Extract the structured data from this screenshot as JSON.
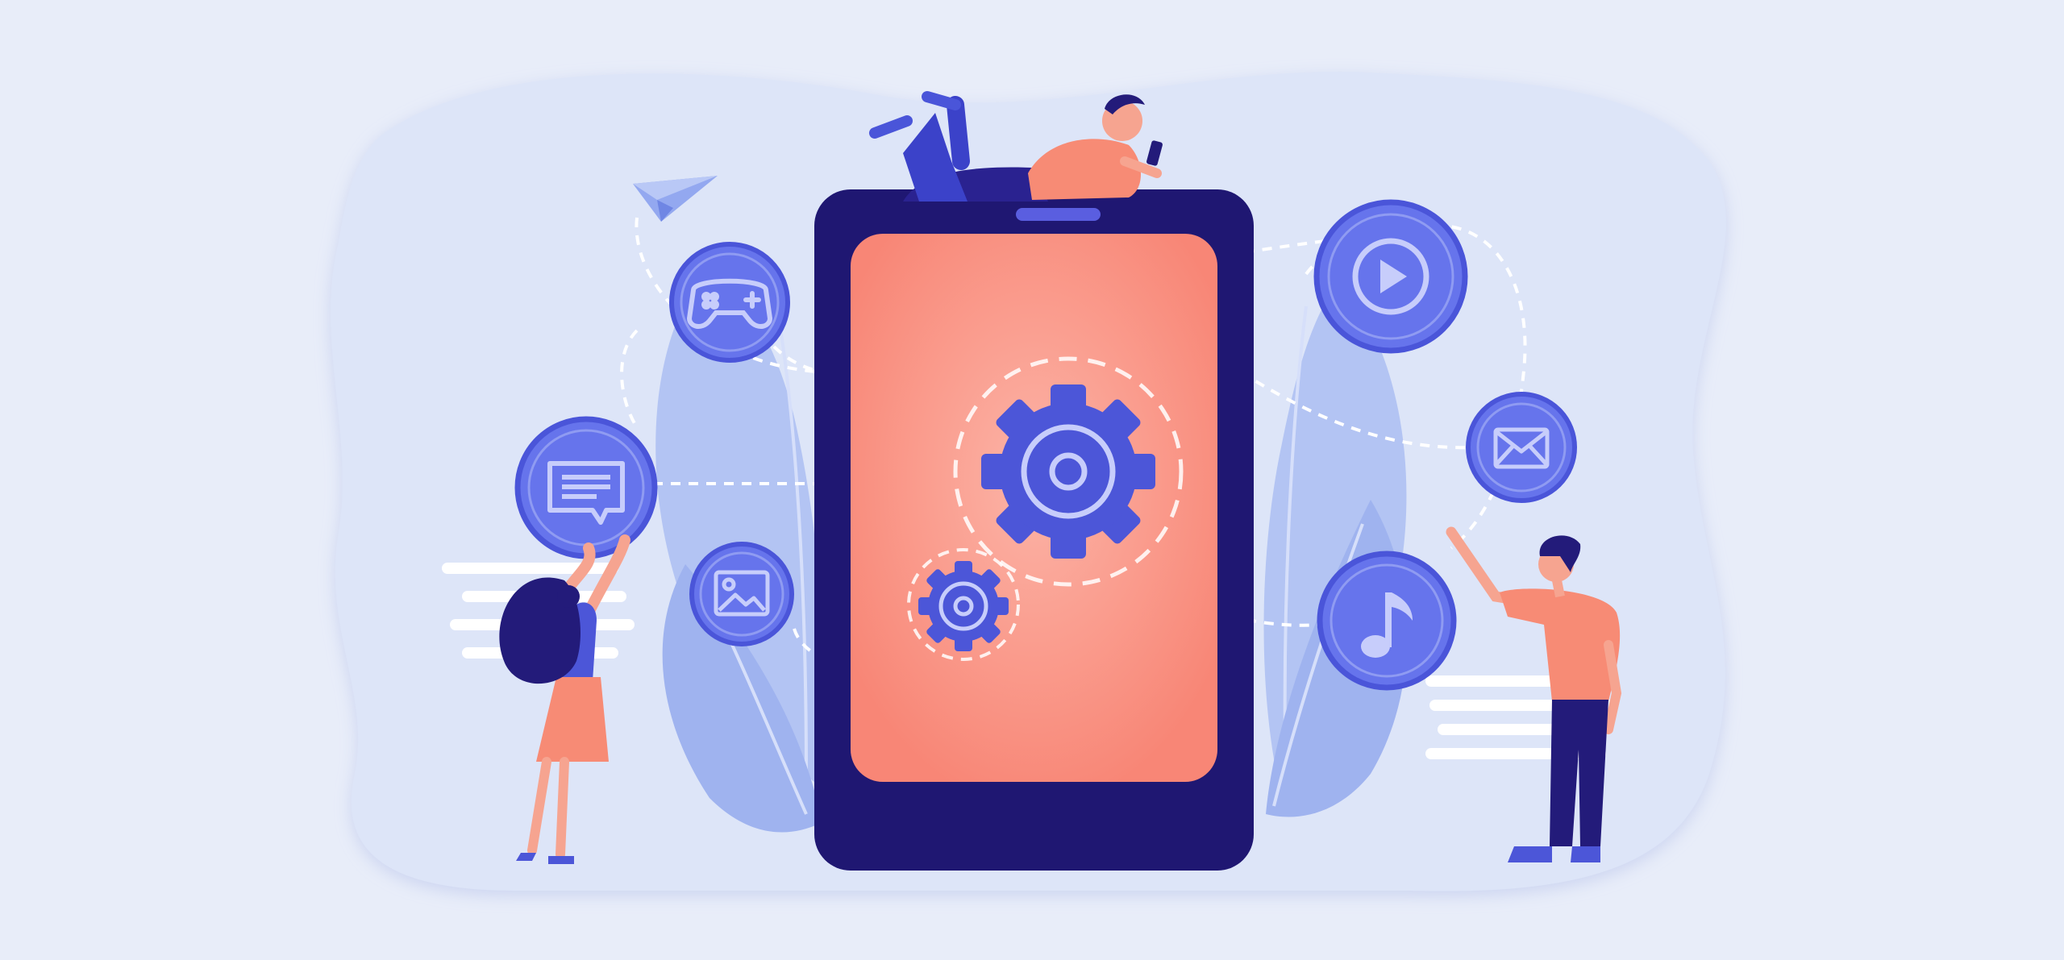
{
  "colors": {
    "background": "#e8edf9",
    "backdrop_blob": "#dde5f8",
    "leaf_light": "#b8c8f4",
    "leaf_mid": "#9db2ef",
    "tablet_frame": "#1f1772",
    "tablet_screen": "#f88d7f",
    "tablet_screen_glow": "#fbab9e",
    "icon_circle_fill": "#6674ec",
    "icon_circle_ring": "#4a55d9",
    "icon_glyph": "#c7cdfb",
    "gear": "#4c56d8",
    "person_shirt": "#f78b75",
    "person_pants": "#231b7a",
    "person_hair": "#231b7a",
    "person_skin": "#f6a490",
    "dashed_line": "#ffffff",
    "speed_lines": "#ffffff"
  },
  "icons": {
    "gamepad": "gamepad-icon",
    "chat": "chat-bubble-icon",
    "image": "image-icon",
    "play": "play-icon",
    "mail": "mail-icon",
    "music": "music-note-icon",
    "paper_plane": "paper-plane-icon",
    "gears": "gear-icon"
  }
}
